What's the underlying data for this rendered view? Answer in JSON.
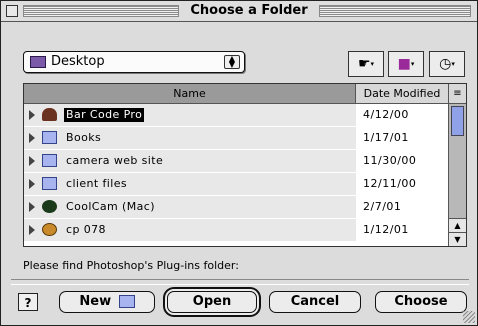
{
  "window": {
    "title": "Choose a Folder"
  },
  "location_popup": {
    "value": "Desktop",
    "arrow_glyph": "↕"
  },
  "toolbar": {
    "shortcuts_glyph": "☛",
    "favorites_glyph": "■",
    "recent_glyph": "◷",
    "menu_arrow": "▾"
  },
  "list": {
    "columns": {
      "name": "Name",
      "date": "Date Modified",
      "sort_glyph": "≡"
    },
    "rows": [
      {
        "name": "Bar Code Pro",
        "date": "4/12/00",
        "icon": "person-app-icon",
        "selected": true
      },
      {
        "name": "Books",
        "date": "1/17/01",
        "icon": "folder-icon",
        "selected": false
      },
      {
        "name": "camera web site",
        "date": "11/30/00",
        "icon": "folder-icon",
        "selected": false
      },
      {
        "name": "client files",
        "date": "12/11/00",
        "icon": "folder-icon",
        "selected": false
      },
      {
        "name": "CoolCam (Mac)",
        "date": "2/7/01",
        "icon": "coolcam-icon",
        "selected": false
      },
      {
        "name": "cp 078",
        "date": "1/12/01",
        "icon": "disc-icon",
        "selected": false
      }
    ],
    "scroll_up": "▲",
    "scroll_down": "▼"
  },
  "prompt": "Please find Photoshop's Plug-ins folder:",
  "buttons": {
    "help": "?",
    "new": "New",
    "open": "Open",
    "cancel": "Cancel",
    "choose": "Choose"
  },
  "colors": {
    "selection": "#000000",
    "folder": "#a8b4f0",
    "scroll_thumb": "#8fa2e8"
  }
}
